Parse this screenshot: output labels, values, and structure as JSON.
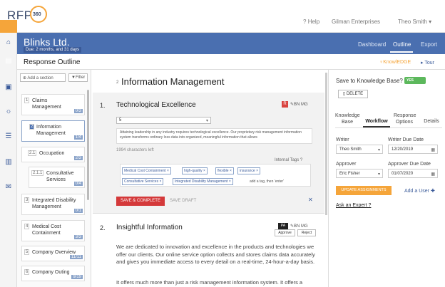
{
  "header": {
    "logo_text": "RFP",
    "logo_number": "360",
    "help": "Help",
    "company": "Gilman Enterprises",
    "user": "Theo Smith"
  },
  "project": {
    "client": "Blinks Ltd.",
    "due": "Due: 2 months, and 31 days",
    "nav": [
      "Dashboard",
      "Outline",
      "Export"
    ],
    "active_nav": "Outline"
  },
  "subheader": {
    "title": "Response Outline",
    "knowledge": "KnowlEDGE",
    "tour": "Tour"
  },
  "outline": {
    "add_section": "Add a section",
    "filter": "Filter",
    "items": [
      {
        "num": "1",
        "label": "Claims Management",
        "count": "0/3"
      },
      {
        "num": "2",
        "label": "Information Management",
        "count": "1/4"
      },
      {
        "num": "2.1",
        "label": "Occupation",
        "count": "2/3"
      },
      {
        "num": "2.1.1",
        "label": "Consultative Services",
        "count": "0/4"
      },
      {
        "num": "3",
        "label": "Integrated Disability Management",
        "count": "0/1"
      },
      {
        "num": "4",
        "label": "Medical Cost Containment",
        "count": "3/3"
      },
      {
        "num": "5",
        "label": "Company Overview",
        "count": "11/11"
      },
      {
        "num": "6",
        "label": "Company Outing",
        "count": "9/19"
      }
    ]
  },
  "section": {
    "number": "2",
    "title": "Information Management"
  },
  "question1": {
    "number": "1.",
    "title": "Technological Excellence",
    "badge": "R",
    "meta": "BN MG",
    "select_value": "5",
    "answer": "Attaining leadership in any industry requires technological excellence. Our proprietary risk management information system transforms ordinary loss data into organized, meaningful information that allows",
    "char_count": "1994 characters left",
    "tags_label": "Internal Tags",
    "tags": [
      "Medical Cost Containment",
      "high-quality",
      "flexible",
      "insurance",
      "Consultative Services",
      "Integrated Disability Management"
    ],
    "tag_placeholder": "add a tag, then 'enter'",
    "save_label": "SAVE & COMPLETE",
    "draft_label": "SAVE DRAFT",
    "close": "✕"
  },
  "question2": {
    "number": "2.",
    "title": "Insightful Information",
    "badge": "PA",
    "meta": "BN MG",
    "approve": "Approve",
    "reject": "Reject",
    "body": "We are dedicated to innovation and excellence in the products and technologies we offer our clients. Our online service option collects and stores claims data accurately and gives you immediate access to every detail on a real-time, 24-hour-a-day basis.",
    "body2": "It offers much more than just a risk management information system. It offers a"
  },
  "right_panel": {
    "kb_question": "Save to Knowledge Base?",
    "toggle": "YES",
    "delete": "DELETE",
    "tabs": [
      "Knowledge Base",
      "Workflow",
      "Response Options",
      "Details"
    ],
    "active_tab": "Workflow",
    "writer_label": "Writer",
    "writer_value": "Theo Smith",
    "writer_due_label": "Writer Due Date",
    "writer_due_value": "12/20/2019",
    "approver_label": "Approver",
    "approver_value": "Eric Fisher",
    "approver_due_label": "Approver Due Date",
    "approver_due_value": "01/07/2020",
    "update": "UPDATE ASSIGNMENTS",
    "add_user": "Add a User",
    "ask_expert": "Ask an Expert"
  },
  "colors": {
    "brand_blue": "#4a6fb0",
    "accent_orange": "#f5a53a",
    "danger_red": "#d4393a",
    "success_green": "#5cb85c"
  }
}
